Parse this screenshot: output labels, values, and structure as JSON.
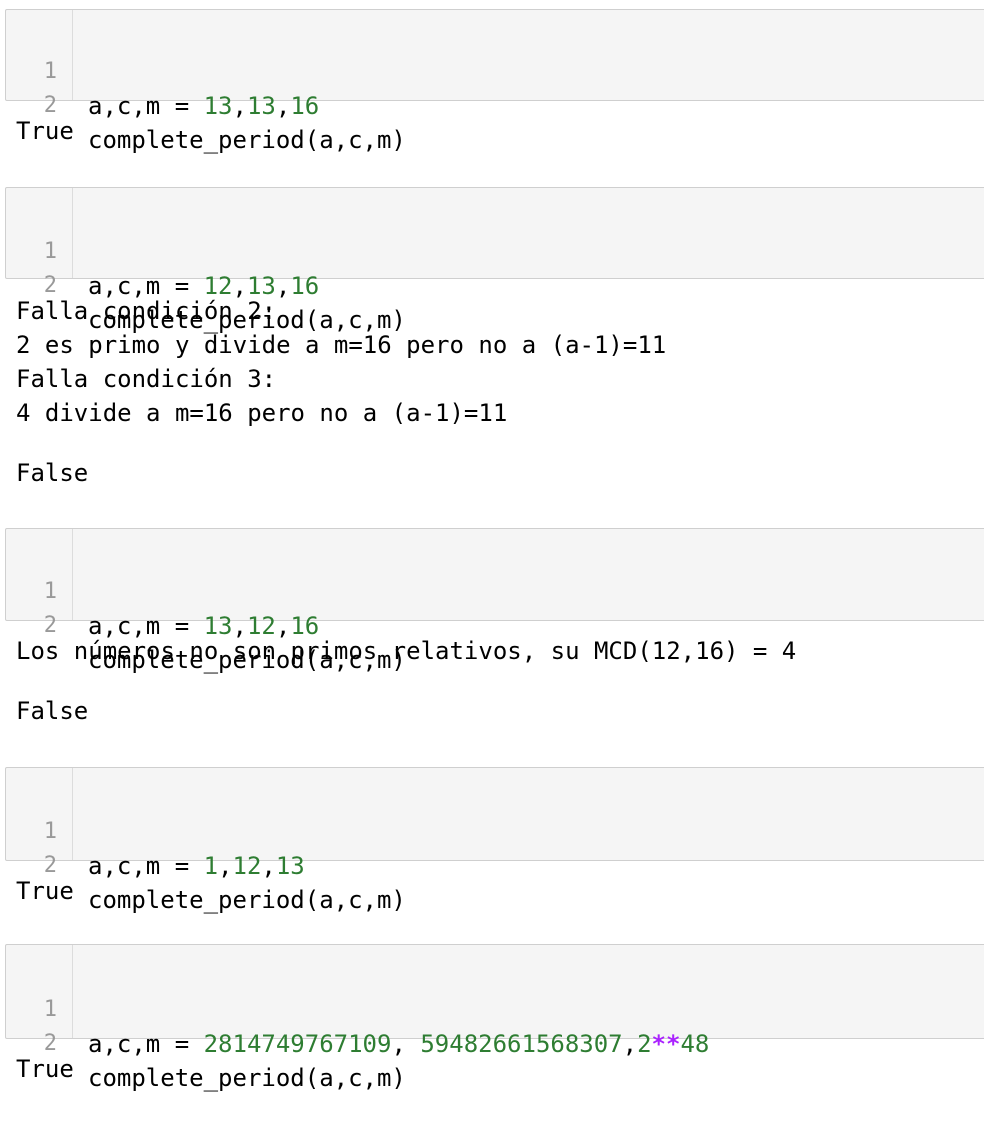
{
  "colors": {
    "cell_background": "#f5f5f5",
    "cell_border": "#cfcfcf",
    "line_number": "#999999",
    "number_literal": "#2e7d32",
    "operator": "#aa22ff"
  },
  "cells": [
    {
      "lines": [
        {
          "num": "1",
          "prefix": "a,c,m = ",
          "n1": "13",
          "s1": ",",
          "n2": "13",
          "s2": ",",
          "n3": "16"
        },
        {
          "num": "2",
          "text": "complete_period(a,c,m)"
        }
      ],
      "stream": [],
      "result": "True"
    },
    {
      "lines": [
        {
          "num": "1",
          "prefix": "a,c,m = ",
          "n1": "12",
          "s1": ",",
          "n2": "13",
          "s2": ",",
          "n3": "16"
        },
        {
          "num": "2",
          "text": "complete_period(a,c,m)"
        }
      ],
      "stream": [
        "Falla condición 2:",
        "2 es primo y divide a m=16 pero no a (a-1)=11",
        "Falla condición 3:",
        "4 divide a m=16 pero no a (a-1)=11"
      ],
      "result": "False"
    },
    {
      "lines": [
        {
          "num": "1",
          "prefix": "a,c,m = ",
          "n1": "13",
          "s1": ",",
          "n2": "12",
          "s2": ",",
          "n3": "16"
        },
        {
          "num": "2",
          "text": "complete_period(a,c,m)"
        }
      ],
      "stream": [
        "Los números no son primos relativos, su MCD(12,16) = 4"
      ],
      "result": "False"
    },
    {
      "lines": [
        {
          "num": "1",
          "prefix": "a,c,m = ",
          "n1": "1",
          "s1": ",",
          "n2": "12",
          "s2": ",",
          "n3": "13"
        },
        {
          "num": "2",
          "text": "complete_period(a,c,m)"
        }
      ],
      "stream": [],
      "result": "True"
    },
    {
      "lines": [
        {
          "num": "1",
          "prefix": "a,c,m = ",
          "n1": "2814749767109",
          "s1": ", ",
          "n2": "59482661568307",
          "s2": ",",
          "n3": "2",
          "op": "**",
          "n4": "48"
        },
        {
          "num": "2",
          "text": "complete_period(a,c,m)"
        }
      ],
      "stream": [],
      "result": "True"
    }
  ]
}
